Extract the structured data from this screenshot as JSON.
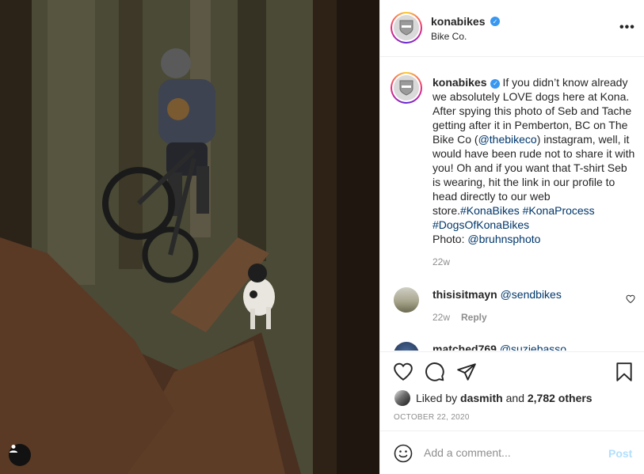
{
  "colors": {
    "link": "#00376b",
    "verified": "#3897f0",
    "muted": "#8e8e8e",
    "post_disabled": "#b2dffc",
    "text": "#262626"
  },
  "photo": {
    "user_tag_icon": "person-icon"
  },
  "header": {
    "username": "konabikes",
    "subtitle": "Bike Co.",
    "more_icon": "more-options-icon",
    "more_label": "•••"
  },
  "caption": {
    "username": "konabikes",
    "text_1": "If you didn’t know already we absolutely LOVE dogs here at Kona. After spying this photo of Seb and Tache getting after it in Pemberton, BC on The Bike Co (",
    "mention_1": "@thebikeco",
    "text_2": ") instagram, well, it would have been rude not to share it with you! Oh and if you want that T-shirt Seb is wearing, hit the link in our profile to head directly to our web store.",
    "tag_1": "#KonaBikes",
    "tag_2": "#KonaProcess",
    "tag_3": "#DogsOfKonaBikes",
    "text_3": "Photo: ",
    "mention_2": "@bruhnsphoto",
    "time": "22w"
  },
  "comments": [
    {
      "username": "thisisitmayn",
      "mention": "@sendbikes",
      "time": "22w",
      "reply_label": "Reply"
    },
    {
      "username": "matched769",
      "mention": "@suziebasso"
    }
  ],
  "actions": {
    "icons": [
      "heart-icon",
      "comment-icon",
      "share-icon",
      "bookmark-icon"
    ],
    "liked_by_prefix": "Liked by",
    "liked_by_user": "dasmith",
    "liked_by_and": "and",
    "liked_by_count": "2,782 others",
    "date": "OCTOBER 22, 2020"
  },
  "add_comment": {
    "placeholder": "Add a comment...",
    "post_label": "Post",
    "emoji_icon": "emoji-icon"
  }
}
